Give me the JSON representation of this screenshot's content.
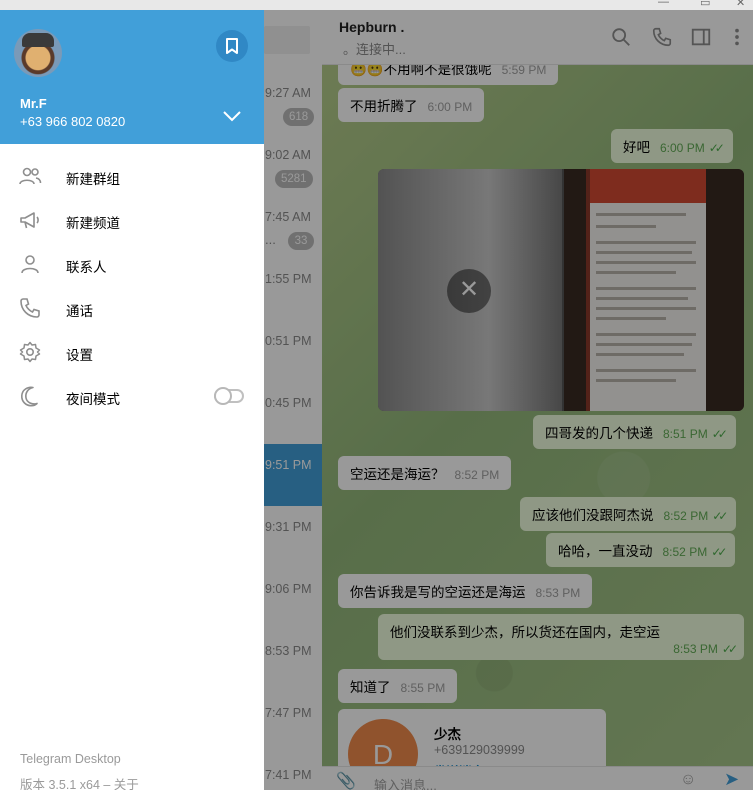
{
  "drawer": {
    "user_name": "Mr.F",
    "user_phone": "+63 966 802 0820",
    "menu": [
      {
        "label": "新建群组",
        "icon": "group-icon"
      },
      {
        "label": "新建频道",
        "icon": "megaphone-icon"
      },
      {
        "label": "联系人",
        "icon": "person-icon"
      },
      {
        "label": "通话",
        "icon": "phone-icon"
      },
      {
        "label": "设置",
        "icon": "gear-icon"
      },
      {
        "label": "夜间模式",
        "icon": "moon-icon",
        "toggle_on": false
      }
    ],
    "app_name": "Telegram Desktop",
    "app_version": "版本 3.5.1 x64 – 关于"
  },
  "chatlist": {
    "rows": [
      {
        "time": "9:27 AM",
        "badge": "618"
      },
      {
        "time": "9:02 AM",
        "badge": "5281"
      },
      {
        "time": "7:45 AM",
        "badge": "33",
        "snip": "..."
      },
      {
        "time": "1:55 PM"
      },
      {
        "time": "0:51 PM"
      },
      {
        "time": "0:45 PM"
      },
      {
        "time": "9:51 PM",
        "active": true
      },
      {
        "time": "9:31 PM"
      },
      {
        "time": "9:06 PM"
      },
      {
        "time": "8:53 PM"
      },
      {
        "time": "7:47 PM"
      },
      {
        "time": "7:41 PM"
      }
    ]
  },
  "conversation": {
    "title": "Hepburn .",
    "status": "。连接中...",
    "messages": [
      {
        "text": "😬😬不用啊不是很饿呢",
        "time": "5:59 PM",
        "dir": "in"
      },
      {
        "text": "不用折腾了",
        "time": "6:00 PM",
        "dir": "in"
      },
      {
        "text": "好吧",
        "time": "6:00 PM",
        "dir": "out"
      },
      {
        "text": "四哥发的几个快递",
        "time": "8:51 PM",
        "dir": "out"
      },
      {
        "text": "空运还是海运？",
        "time": "8:52 PM",
        "dir": "in"
      },
      {
        "text": "应该他们没跟阿杰说",
        "time": "8:52 PM",
        "dir": "out"
      },
      {
        "text": "哈哈，一直没动",
        "time": "8:52 PM",
        "dir": "out"
      },
      {
        "text": "你告诉我是写的空运还是海运",
        "time": "8:53 PM",
        "dir": "in"
      },
      {
        "text": "他们没联系到少杰，所以货还在国内，走空运",
        "time": "8:53 PM",
        "dir": "out"
      },
      {
        "text": "知道了",
        "time": "8:55 PM",
        "dir": "in"
      }
    ],
    "contact": {
      "initial": "D",
      "name": "少杰",
      "phone": "+639129039999",
      "action": "发送消息"
    },
    "composer_placeholder": "输入消息..."
  },
  "colors": {
    "accent": "#419fd9",
    "outgoing": "#effdde",
    "check": "#4fae4e"
  }
}
